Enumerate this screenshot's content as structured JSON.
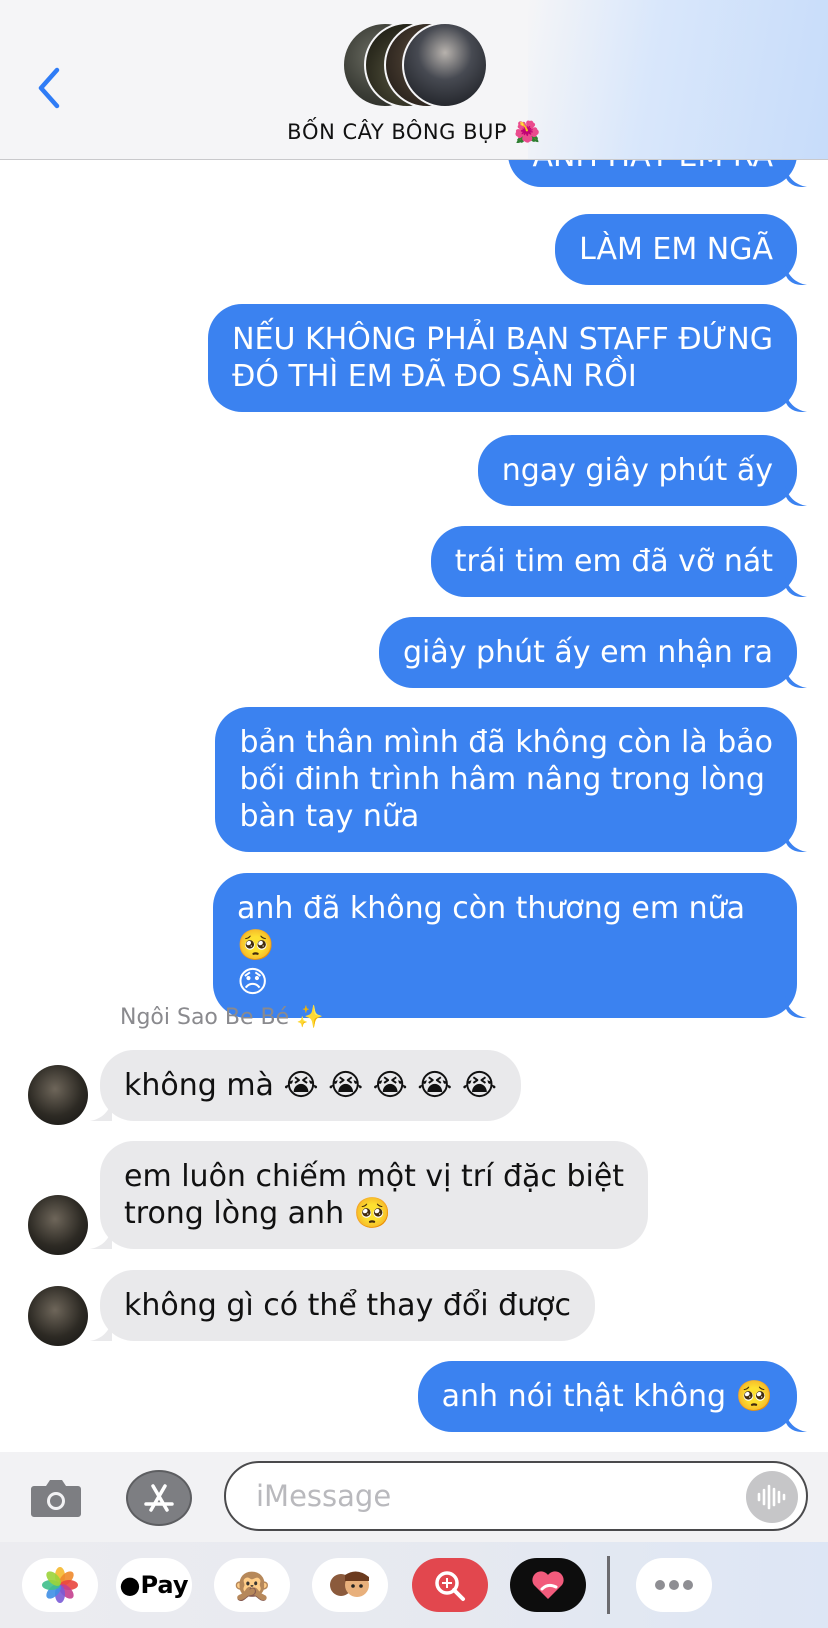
{
  "header": {
    "title": "BỐN CÂY BÔNG BỤP 🌺",
    "back_icon": "chevron-left-icon"
  },
  "messages": [
    {
      "dir": "out",
      "text": "ANH HẤT EM RA"
    },
    {
      "dir": "out",
      "text": "LÀM EM NGÃ"
    },
    {
      "dir": "out",
      "text": "NẾU KHÔNG PHẢI BẠN STAFF ĐỨNG\nĐÓ THÌ EM ĐÃ ĐO SÀN RỒI"
    },
    {
      "dir": "out",
      "text": "ngay giây phút ấy"
    },
    {
      "dir": "out",
      "text": "trái tim em đã vỡ nát"
    },
    {
      "dir": "out",
      "text": "giây phút ấy em nhận ra"
    },
    {
      "dir": "out",
      "text": "bản thân mình đã không còn là bảo\nbối đinh trình hâm nâng trong lòng\nbàn tay nữa"
    },
    {
      "dir": "out",
      "text": "anh đã không còn thương em nữa 🥺\n😞"
    },
    {
      "dir": "in",
      "text": "không mà 😭 😭 😭 😭 😭"
    },
    {
      "dir": "in",
      "text": "em luôn chiếm một vị trí đặc biệt\ntrong lòng anh 🥺"
    },
    {
      "dir": "in",
      "text": "không gì có thể thay đổi được"
    },
    {
      "dir": "out",
      "text": "anh nói thật không 🥺"
    }
  ],
  "sender_name": "Ngôi Sao Be Bé ✨",
  "input": {
    "placeholder": "iMessage"
  },
  "app_drawer": {
    "items": [
      "photos-icon",
      "apple-pay-icon",
      "monkey-emoji-icon",
      "memoji-icon",
      "image-search-icon",
      "digital-touch-icon",
      "more-icon"
    ],
    "apple_pay_label": "Pay",
    "monkey": "🙊"
  },
  "colors": {
    "outgoing_bubble": "#3b82f0",
    "incoming_bubble": "#e9e9eb",
    "accent": "#2f7cf6"
  }
}
